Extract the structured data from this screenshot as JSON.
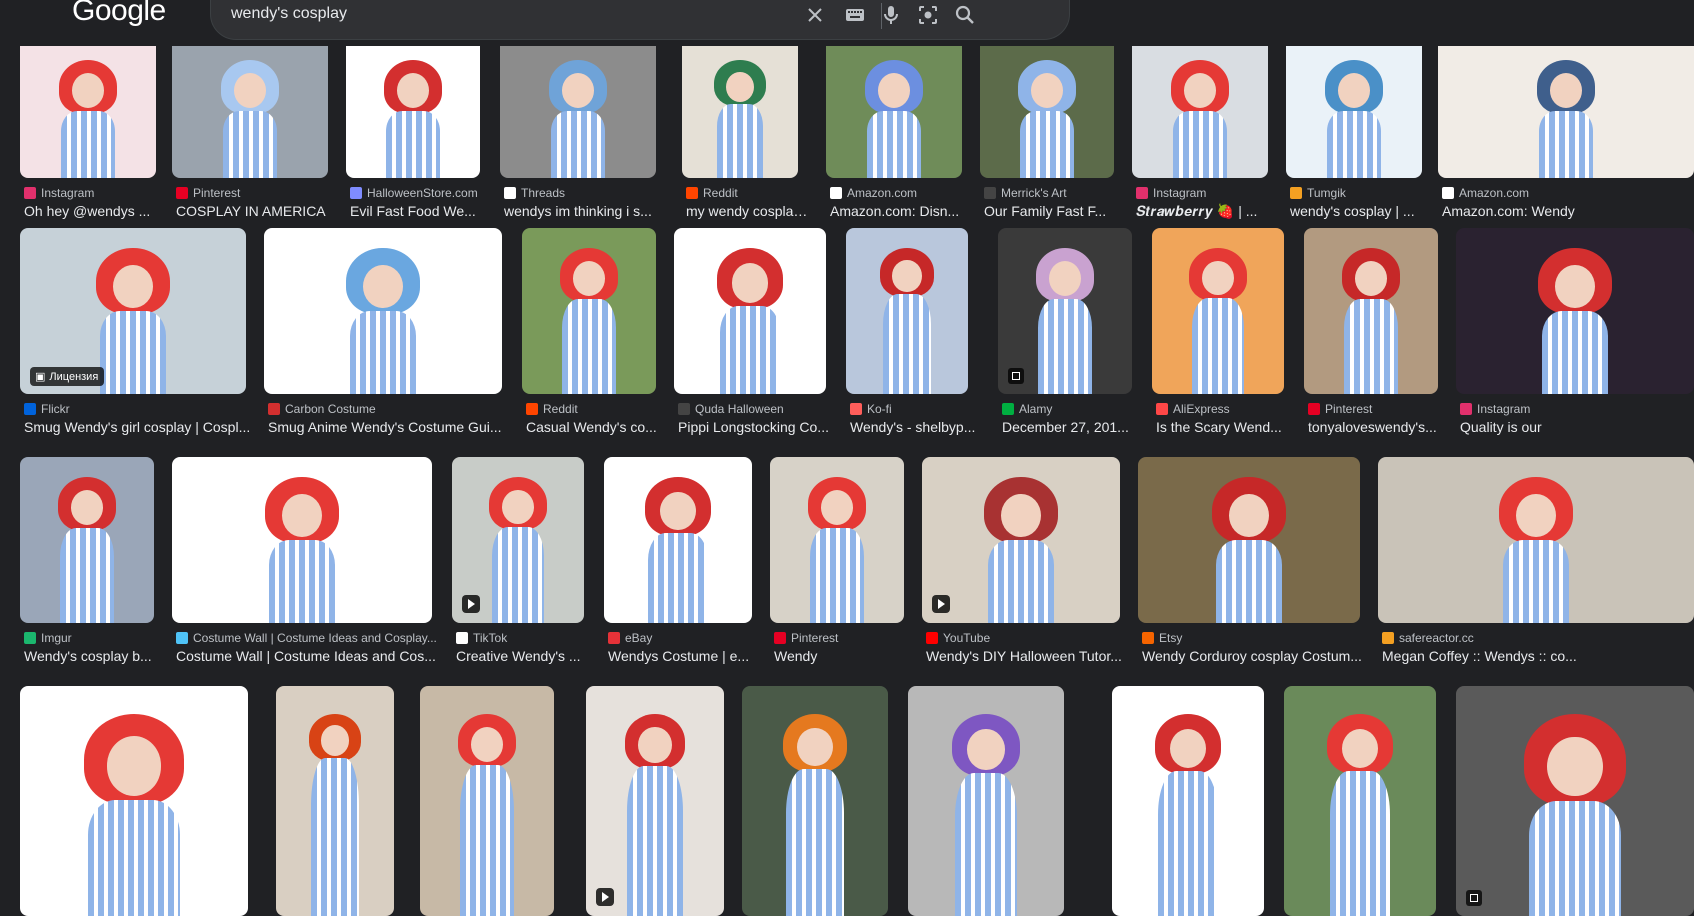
{
  "header": {
    "logo": "Google",
    "query": "wendy's cosplay",
    "icons": [
      "close-icon",
      "keyboard-icon",
      "mic-icon",
      "lens-icon",
      "search-icon"
    ]
  },
  "results": [
    {
      "source": "Instagram",
      "title": "Oh hey @wendys ...",
      "fav": "#e1306c",
      "bg": "#f4e2e6",
      "accent": "#e53935",
      "badge": ""
    },
    {
      "source": "Pinterest",
      "title": "COSPLAY IN AMERICA",
      "fav": "#e60023",
      "bg": "#9aa3ad",
      "accent": "#a8c8f0",
      "badge": ""
    },
    {
      "source": "HalloweenStore.com",
      "title": "Evil Fast Food We...",
      "fav": "#7f8cff",
      "bg": "#ffffff",
      "accent": "#d32f2f",
      "badge": ""
    },
    {
      "source": "Threads",
      "title": "wendys im thinking i s...",
      "fav": "#ffffff",
      "bg": "#8c8c8c",
      "accent": "#6fa3d8",
      "badge": ""
    },
    {
      "source": "Reddit",
      "title": "my wendy cosplay!...",
      "fav": "#ff4500",
      "bg": "#e5e0d6",
      "accent": "#2e7d4f",
      "badge": ""
    },
    {
      "source": "Amazon.com",
      "title": "Amazon.com: Disn...",
      "fav": "#ffffff",
      "bg": "#6f8c59",
      "accent": "#6c8fe0",
      "badge": ""
    },
    {
      "source": "Merrick's Art",
      "title": "Our Family Fast F...",
      "fav": "#444444",
      "bg": "#5c6b4a",
      "accent": "#8fb4e8",
      "badge": ""
    },
    {
      "source": "Instagram",
      "title": "𝑺𝒕𝒓𝒂𝒘𝒃𝒆𝒓𝒓𝒚 🍓 | ...",
      "fav": "#e1306c",
      "bg": "#d9dde2",
      "accent": "#e53935",
      "badge": ""
    },
    {
      "source": "Tumgik",
      "title": "wendy's cosplay | ...",
      "fav": "#f4a022",
      "bg": "#eaf2f8",
      "accent": "#4a90c8",
      "badge": ""
    },
    {
      "source": "Amazon.com",
      "title": "Amazon.com: Wendy",
      "fav": "#ffffff",
      "bg": "#f1ece6",
      "accent": "#3f5f8c",
      "badge": ""
    },
    {
      "source": "Flickr",
      "title": "Smug Wendy's girl cosplay | Cospl...",
      "fav": "#0063dc",
      "bg": "#c6d1d8",
      "accent": "#e53935",
      "badge": "Лицензия"
    },
    {
      "source": "Carbon Costume",
      "title": "Smug Anime Wendy's Costume Gui...",
      "fav": "#d32f2f",
      "bg": "#ffffff",
      "accent": "#6aa7e0",
      "badge": ""
    },
    {
      "source": "Reddit",
      "title": "Casual Wendy's co...",
      "fav": "#ff4500",
      "bg": "#7a9a5a",
      "accent": "#e53935",
      "badge": ""
    },
    {
      "source": "Quda Halloween",
      "title": "Pippi Longstocking Co...",
      "fav": "#444444",
      "bg": "#ffffff",
      "accent": "#d32f2f",
      "badge": ""
    },
    {
      "source": "Ko-fi",
      "title": "Wendy's - shelbyp...",
      "fav": "#ff5e5b",
      "bg": "#b9c7dc",
      "accent": "#c62828",
      "badge": ""
    },
    {
      "source": "Alamy",
      "title": "December 27, 201...",
      "fav": "#00af41",
      "bg": "#3a3a3a",
      "accent": "#c9a2d0",
      "badge": "img"
    },
    {
      "source": "AliExpress",
      "title": "Is the Scary Wend...",
      "fav": "#ff4747",
      "bg": "#f0a55a",
      "accent": "#e53935",
      "badge": ""
    },
    {
      "source": "Pinterest",
      "title": "tonyaloveswendy's...",
      "fav": "#e60023",
      "bg": "#b29a80",
      "accent": "#c62828",
      "badge": ""
    },
    {
      "source": "Instagram",
      "title": "Quality is our",
      "fav": "#e1306c",
      "bg": "#2a2230",
      "accent": "#d32f2f",
      "badge": ""
    },
    {
      "source": "Imgur",
      "title": "Wendy's cosplay b...",
      "fav": "#1bb76e",
      "bg": "#9aa6b8",
      "accent": "#d32f2f",
      "badge": ""
    },
    {
      "source": "Costume Wall | Costume Ideas and Cosplay...",
      "title": "Costume Wall | Costume Ideas and Cos...",
      "fav": "#4fc3f7",
      "bg": "#ffffff",
      "accent": "#e53935",
      "badge": ""
    },
    {
      "source": "TikTok",
      "title": "Creative Wendy's ...",
      "fav": "#ffffff",
      "bg": "#c8ccc8",
      "accent": "#e53935",
      "badge": "play"
    },
    {
      "source": "eBay",
      "title": "Wendys Costume | e...",
      "fav": "#e53238",
      "bg": "#ffffff",
      "accent": "#d32f2f",
      "badge": ""
    },
    {
      "source": "Pinterest",
      "title": "Wendy",
      "fav": "#e60023",
      "bg": "#d7d2c8",
      "accent": "#e53935",
      "badge": ""
    },
    {
      "source": "YouTube",
      "title": "Wendy's DIY Halloween Tutor...",
      "fav": "#ff0000",
      "bg": "#d8d0c4",
      "accent": "#a83232",
      "badge": "play"
    },
    {
      "source": "Etsy",
      "title": "Wendy Corduroy cosplay Costum...",
      "fav": "#f56400",
      "bg": "#7a6a4a",
      "accent": "#c62828",
      "badge": ""
    },
    {
      "source": "safereactor.cc",
      "title": "Megan Coffey :: Wendys :: co...",
      "fav": "#f4a022",
      "bg": "#c9c3b8",
      "accent": "#e53935",
      "badge": ""
    },
    {
      "source": "",
      "title": "",
      "fav": "",
      "bg": "#ffffff",
      "accent": "#e53935",
      "badge": ""
    },
    {
      "source": "",
      "title": "",
      "fav": "",
      "bg": "#d9cfc2",
      "accent": "#d84315",
      "badge": ""
    },
    {
      "source": "",
      "title": "",
      "fav": "",
      "bg": "#c7b9a6",
      "accent": "#e53935",
      "badge": ""
    },
    {
      "source": "",
      "title": "",
      "fav": "",
      "bg": "#e6e1dc",
      "accent": "#d32f2f",
      "badge": "play"
    },
    {
      "source": "",
      "title": "",
      "fav": "",
      "bg": "#4a5a48",
      "accent": "#e5791f",
      "badge": ""
    },
    {
      "source": "",
      "title": "",
      "fav": "",
      "bg": "#b8b8b8",
      "accent": "#7e57c2",
      "badge": ""
    },
    {
      "source": "",
      "title": "",
      "fav": "",
      "bg": "#ffffff",
      "accent": "#d32f2f",
      "badge": ""
    },
    {
      "source": "",
      "title": "",
      "fav": "",
      "bg": "#6a8a5a",
      "accent": "#e53935",
      "badge": ""
    },
    {
      "source": "",
      "title": "",
      "fav": "",
      "bg": "#5a5a5a",
      "accent": "#d32f2f",
      "badge": "img"
    }
  ]
}
